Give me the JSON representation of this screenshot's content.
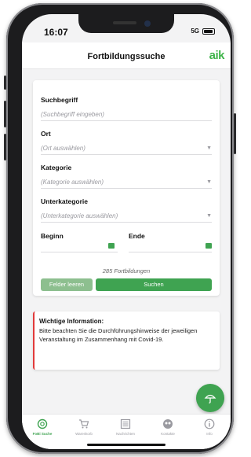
{
  "status_bar": {
    "time": "16:07",
    "network": "5G"
  },
  "header": {
    "title": "Fortbildungssuche",
    "logo": "aik"
  },
  "form": {
    "search_label": "Suchbegriff",
    "search_placeholder": "(Suchbegriff eingeben)",
    "location_label": "Ort",
    "location_placeholder": "(Ort auswählen)",
    "category_label": "Kategorie",
    "category_placeholder": "(Kategorie auswählen)",
    "subcategory_label": "Unterkategorie",
    "subcategory_placeholder": "(Unterkategorie auswählen)",
    "begin_label": "Beginn",
    "end_label": "Ende",
    "result_count": "285 Fortbildungen",
    "clear_label": "Felder leeren",
    "search_button": "Suchen"
  },
  "info": {
    "title": "Wichtige Information:",
    "text": "Bitte beachten Sie die Durchführungshinweise der jeweiligen Veranstaltung im Zusammenhang mit Covid-19."
  },
  "tabs": [
    {
      "label": "FoBi Suche",
      "icon": "search-icon",
      "active": true
    },
    {
      "label": "Warenkorb",
      "icon": "cart-icon",
      "active": false
    },
    {
      "label": "Nachrichten",
      "icon": "news-icon",
      "active": false
    },
    {
      "label": "Kontakte",
      "icon": "contacts-icon",
      "active": false
    },
    {
      "label": "Info",
      "icon": "info-icon",
      "active": false
    }
  ],
  "colors": {
    "accent": "#3fa351",
    "accent_light": "#8dbf8f",
    "alert": "#e23b3b"
  }
}
